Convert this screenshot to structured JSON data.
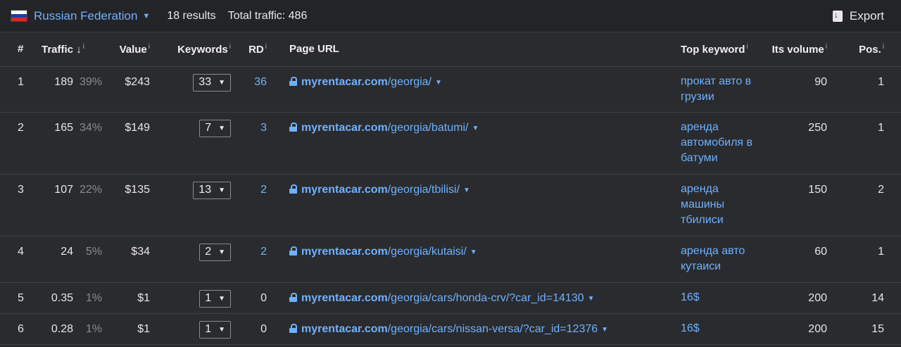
{
  "header": {
    "country": "Russian Federation",
    "results": "18 results",
    "total_traffic": "Total traffic: 486",
    "export_label": "Export"
  },
  "columns": {
    "num": "#",
    "traffic": "Traffic",
    "traffic_sort": "↓",
    "value": "Value",
    "keywords": "Keywords",
    "rd": "RD",
    "page_url": "Page URL",
    "top_keyword": "Top keyword",
    "its_volume": "Its volume",
    "pos": "Pos.",
    "info": "i"
  },
  "rows": [
    {
      "n": "1",
      "traffic": "189",
      "pct": "39%",
      "value": "$243",
      "keywords": "33",
      "rd": "36",
      "domain": "myrentacar.com",
      "path": "/georgia/",
      "top_kw_lines": [
        "прокат авто в",
        "грузии"
      ],
      "volume": "90",
      "pos": "1"
    },
    {
      "n": "2",
      "traffic": "165",
      "pct": "34%",
      "value": "$149",
      "keywords": "7",
      "rd": "3",
      "domain": "myrentacar.com",
      "path": "/georgia/batumi/",
      "top_kw_lines": [
        "аренда",
        "автомобиля в",
        "батуми"
      ],
      "volume": "250",
      "pos": "1"
    },
    {
      "n": "3",
      "traffic": "107",
      "pct": "22%",
      "value": "$135",
      "keywords": "13",
      "rd": "2",
      "domain": "myrentacar.com",
      "path": "/georgia/tbilisi/",
      "top_kw_lines": [
        "аренда",
        "машины",
        "тбилиси"
      ],
      "volume": "150",
      "pos": "2"
    },
    {
      "n": "4",
      "traffic": "24",
      "pct": "5%",
      "value": "$34",
      "keywords": "2",
      "rd": "2",
      "domain": "myrentacar.com",
      "path": "/georgia/kutaisi/",
      "top_kw_lines": [
        "аренда авто",
        "кутаиси"
      ],
      "volume": "60",
      "pos": "1"
    },
    {
      "n": "5",
      "traffic": "0.35",
      "pct": "1%",
      "value": "$1",
      "keywords": "1",
      "rd": "0",
      "domain": "myrentacar.com",
      "path": "/georgia/cars/honda-crv/?car_id=14130",
      "top_kw_lines": [
        "16$"
      ],
      "volume": "200",
      "pos": "14"
    },
    {
      "n": "6",
      "traffic": "0.28",
      "pct": "1%",
      "value": "$1",
      "keywords": "1",
      "rd": "0",
      "domain": "myrentacar.com",
      "path": "/georgia/cars/nissan-versa/?car_id=12376",
      "top_kw_lines": [
        "16$"
      ],
      "volume": "200",
      "pos": "15"
    }
  ]
}
